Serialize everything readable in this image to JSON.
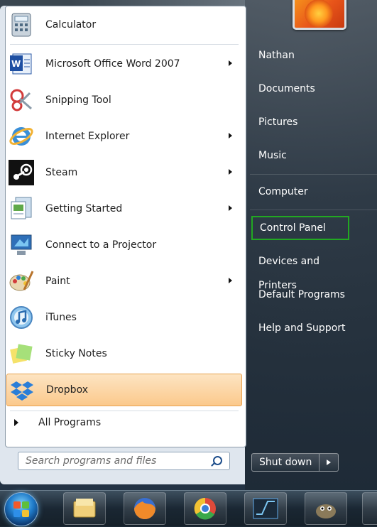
{
  "left_programs": [
    {
      "label": "Calculator",
      "icon": "calculator-icon",
      "has_arrow": false
    },
    {
      "label": "Microsoft Office Word 2007",
      "icon": "word-icon",
      "has_arrow": true
    },
    {
      "label": "Snipping Tool",
      "icon": "scissors-icon",
      "has_arrow": false
    },
    {
      "label": "Internet Explorer",
      "icon": "internet-explorer-icon",
      "has_arrow": true
    },
    {
      "label": "Steam",
      "icon": "steam-icon",
      "has_arrow": true
    },
    {
      "label": "Getting Started",
      "icon": "getting-started-icon",
      "has_arrow": true
    },
    {
      "label": "Connect to a Projector",
      "icon": "projector-icon",
      "has_arrow": false
    },
    {
      "label": "Paint",
      "icon": "paint-palette-icon",
      "has_arrow": true
    },
    {
      "label": "iTunes",
      "icon": "itunes-icon",
      "has_arrow": false
    },
    {
      "label": "Sticky Notes",
      "icon": "sticky-notes-icon",
      "has_arrow": false
    },
    {
      "label": "Dropbox",
      "icon": "dropbox-icon",
      "has_arrow": false,
      "selected": true
    }
  ],
  "all_programs_label": "All Programs",
  "search": {
    "placeholder": "Search programs and files"
  },
  "right_links": [
    {
      "label": "Nathan"
    },
    {
      "label": "Documents"
    },
    {
      "label": "Pictures"
    },
    {
      "label": "Music"
    },
    {
      "label": "Computer"
    },
    {
      "label": "Control Panel",
      "highlighted": true
    },
    {
      "label": "Devices and Printers"
    },
    {
      "label": "Default Programs"
    },
    {
      "label": "Help and Support"
    }
  ],
  "shutdown_label": "Shut down",
  "taskbar_items": [
    "start-orb-icon",
    "windows-explorer-icon",
    "firefox-icon",
    "chrome-icon",
    "app-icon",
    "gimp-icon"
  ],
  "colors": {
    "highlight_border": "#22a822",
    "selected_bg": "#fbc98c"
  }
}
